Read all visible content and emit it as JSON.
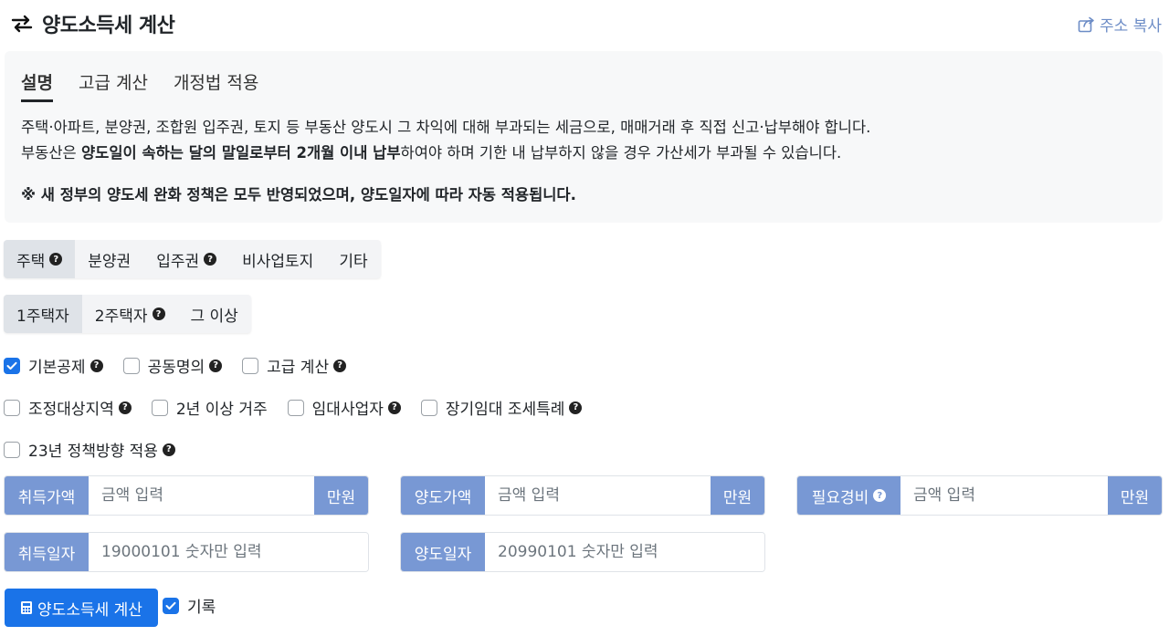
{
  "header": {
    "title": "양도소득세 계산",
    "copy_label": "주소 복사"
  },
  "info": {
    "tabs": [
      {
        "label": "설명",
        "active": true
      },
      {
        "label": "고급 계산",
        "active": false
      },
      {
        "label": "개정법 적용",
        "active": false
      }
    ],
    "line1": "주택·아파트, 분양권, 조합원 입주권, 토지 등 부동산 양도시 그 차익에 대해 부과되는 세금으로, 매매거래 후 직접 신고·납부해야 합니다.",
    "line2_pre": "부동산은 ",
    "line2_bold": "양도일이 속하는 달의 말일로부터 2개월 이내 납부",
    "line2_post": "하여야 하며 기한 내 납부하지 않을 경우 가산세가 부과될 수 있습니다.",
    "notice": "※ 새 정부의 양도세 완화 정책은 모두 반영되었으며, 양도일자에 따라 자동 적용됩니다."
  },
  "property_types": [
    {
      "label": "주택",
      "help": true,
      "active": true
    },
    {
      "label": "분양권",
      "help": false,
      "active": false
    },
    {
      "label": "입주권",
      "help": true,
      "active": false
    },
    {
      "label": "비사업토지",
      "help": false,
      "active": false
    },
    {
      "label": "기타",
      "help": false,
      "active": false
    }
  ],
  "house_counts": [
    {
      "label": "1주택자",
      "help": false,
      "active": true
    },
    {
      "label": "2주택자",
      "help": true,
      "active": false
    },
    {
      "label": "그 이상",
      "help": false,
      "active": false
    }
  ],
  "options_row1": [
    {
      "label": "기본공제",
      "help": true,
      "checked": true
    },
    {
      "label": "공동명의",
      "help": true,
      "checked": false
    },
    {
      "label": "고급 계산",
      "help": true,
      "checked": false
    }
  ],
  "options_row2": [
    {
      "label": "조정대상지역",
      "help": true,
      "checked": false
    },
    {
      "label": "2년 이상 거주",
      "help": false,
      "checked": false
    },
    {
      "label": "임대사업자",
      "help": true,
      "checked": false
    },
    {
      "label": "장기임대 조세특례",
      "help": true,
      "checked": false
    }
  ],
  "options_row3": [
    {
      "label": "23년 정책방향 적용",
      "help": true,
      "checked": false
    }
  ],
  "fields": {
    "acq_price": {
      "label": "취득가액",
      "placeholder": "금액 입력",
      "unit": "만원"
    },
    "sale_price": {
      "label": "양도가액",
      "placeholder": "금액 입력",
      "unit": "만원"
    },
    "expense": {
      "label": "필요경비",
      "placeholder": "금액 입력",
      "unit": "만원"
    },
    "acq_date": {
      "label": "취득일자",
      "placeholder": "19000101 숫자만 입력"
    },
    "sale_date": {
      "label": "양도일자",
      "placeholder": "20990101 숫자만 입력"
    }
  },
  "actions": {
    "calc_label": "양도소득세 계산",
    "record_label": "기록",
    "record_checked": true
  },
  "colors": {
    "accent": "#1a73e8",
    "label_bg": "#7898d4",
    "link": "#6c8cc6"
  }
}
